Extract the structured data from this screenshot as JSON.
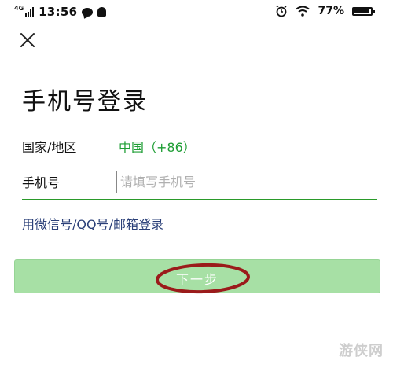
{
  "status_bar": {
    "network": "4G",
    "time": "13:56",
    "battery_percent": "77%"
  },
  "screen": {
    "title": "手机号登录",
    "country_label": "国家/地区",
    "country_value": "中国（+86）",
    "phone_label": "手机号",
    "phone_placeholder": "请填写手机号",
    "phone_value": "",
    "alt_login_link": "用微信号/QQ号/邮箱登录",
    "next_button": "下一步"
  },
  "watermark": "游侠网",
  "colors": {
    "green_text": "#1f9e35",
    "button_bg": "#a7e0a5",
    "link_text": "#2a3f78",
    "annotation": "#9b1b1b"
  },
  "icons": {
    "close": "close-icon",
    "status": [
      "signal-icon",
      "chat-bubble-icon",
      "notification-bell-icon",
      "alarm-icon",
      "wifi-icon",
      "battery-icon"
    ]
  }
}
